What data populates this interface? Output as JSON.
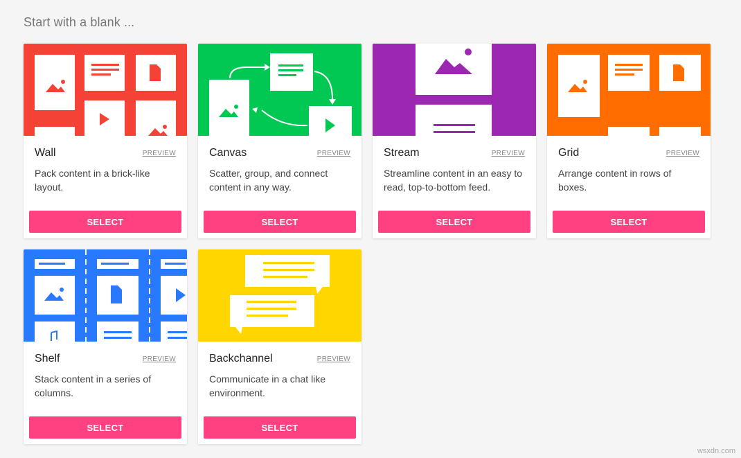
{
  "heading": "Start with a blank ...",
  "preview_label": "PREVIEW",
  "select_label": "SELECT",
  "watermark": "wsxdn.com",
  "cards": [
    {
      "title": "Wall",
      "description": "Pack content in a brick-like layout.",
      "color": "#f44336",
      "thumb_icon": "wall-layout-icon"
    },
    {
      "title": "Canvas",
      "description": "Scatter, group, and connect content in any way.",
      "color": "#00c853",
      "thumb_icon": "canvas-layout-icon"
    },
    {
      "title": "Stream",
      "description": "Streamline content in an easy to read, top-to-bottom feed.",
      "color": "#9c27b0",
      "thumb_icon": "stream-layout-icon"
    },
    {
      "title": "Grid",
      "description": "Arrange content in rows of boxes.",
      "color": "#ff6d00",
      "thumb_icon": "grid-layout-icon"
    },
    {
      "title": "Shelf",
      "description": "Stack content in a series of columns.",
      "color": "#2979ff",
      "thumb_icon": "shelf-layout-icon"
    },
    {
      "title": "Backchannel",
      "description": "Communicate in a chat like environment.",
      "color": "#ffd600",
      "thumb_icon": "backchannel-layout-icon"
    }
  ]
}
